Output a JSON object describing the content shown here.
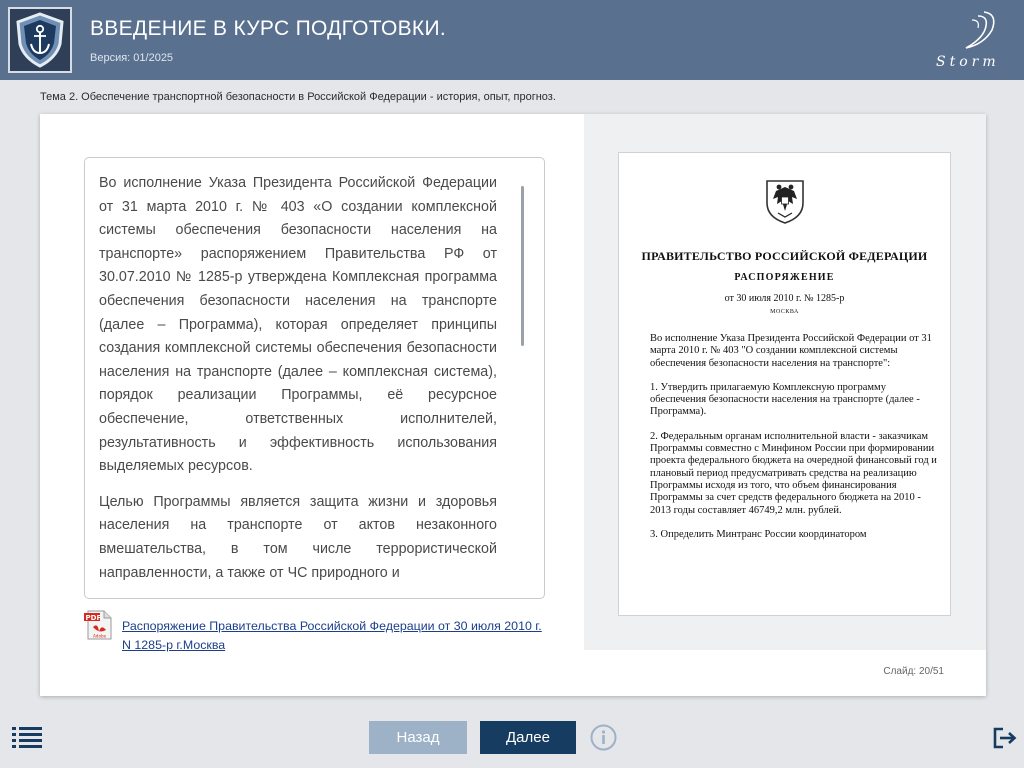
{
  "header": {
    "title": "ВВЕДЕНИЕ В КУРС ПОДГОТОВКИ.",
    "version": "Версия: 01/2025",
    "brand": "Storm",
    "logo_icon": "anchor-shield-icon"
  },
  "topic": "Тема 2. Обеспечение транспортной безопасности в Российской Федерации - история, опыт, прогноз.",
  "text_box": {
    "paragraphs": [
      "Во исполнение Указа Президента Российской Федерации от 31 марта 2010 г. № 403 «О создании комплексной системы обеспечения безопасности населения на транспорте» распоряжением Правительства РФ от 30.07.2010 № 1285-р утверждена Комплексная программа обеспечения безопасности населения на транспорте (далее – Программа), которая определяет принципы создания комплексной системы обеспечения безопасности населения на транспорте (далее – комплексная система), порядок реализации Программы, её ресурсное обеспечение, ответственных исполнителей, результативность и эффективность использования выделяемых ресурсов.",
      "Целью Программы является защита жизни и здоровья населения на транспорте от актов незаконного вмешательства, в том числе террористической направленности, а также от ЧС природного и"
    ]
  },
  "pdf_link": {
    "icon": "pdf-adobe-icon",
    "icon_label": "PDF",
    "icon_sublabel": "Adobe",
    "text": "Распоряжение Правительства Российской Федерации от 30 июля 2010 г. N 1285-р г.Москва"
  },
  "document": {
    "emblem_icon": "coat-of-arms-icon",
    "government": "ПРАВИТЕЛЬСТВО РОССИЙСКОЙ ФЕДЕРАЦИИ",
    "type": "РАСПОРЯЖЕНИЕ",
    "date": "от 30 июля 2010 г. № 1285-р",
    "city": "МОСКВА",
    "paragraphs": [
      "Во исполнение Указа Президента Российской Федерации от 31 марта 2010 г. № 403 \"О создании комплексной системы обеспечения безопасности населения на транспорте\":",
      "1. Утвердить прилагаемую Комплексную программу обеспечения безопасности населения на транспорте (далее - Программа).",
      "2. Федеральным органам исполнительной власти - заказчикам Программы совместно с Минфином России при формировании проекта федерального бюджета на очередной финансовый год и плановый период предусматривать средства на реализацию Программы исходя из того, что объем финансирования Программы за счет средств федерального бюджета на 2010 - 2013 годы составляет 46749,2 млн. рублей.",
      "3. Определить Минтранс России координатором"
    ]
  },
  "slide_counter": "Слайд: 20/51",
  "nav": {
    "back": "Назад",
    "next": "Далее",
    "menu_icon": "menu-list-icon",
    "info_icon": "info-icon",
    "exit_icon": "exit-icon"
  },
  "colors": {
    "header_bg": "#59708f",
    "next_button": "#173c62",
    "back_button": "#9db2c6",
    "link": "#1c3f8a"
  }
}
